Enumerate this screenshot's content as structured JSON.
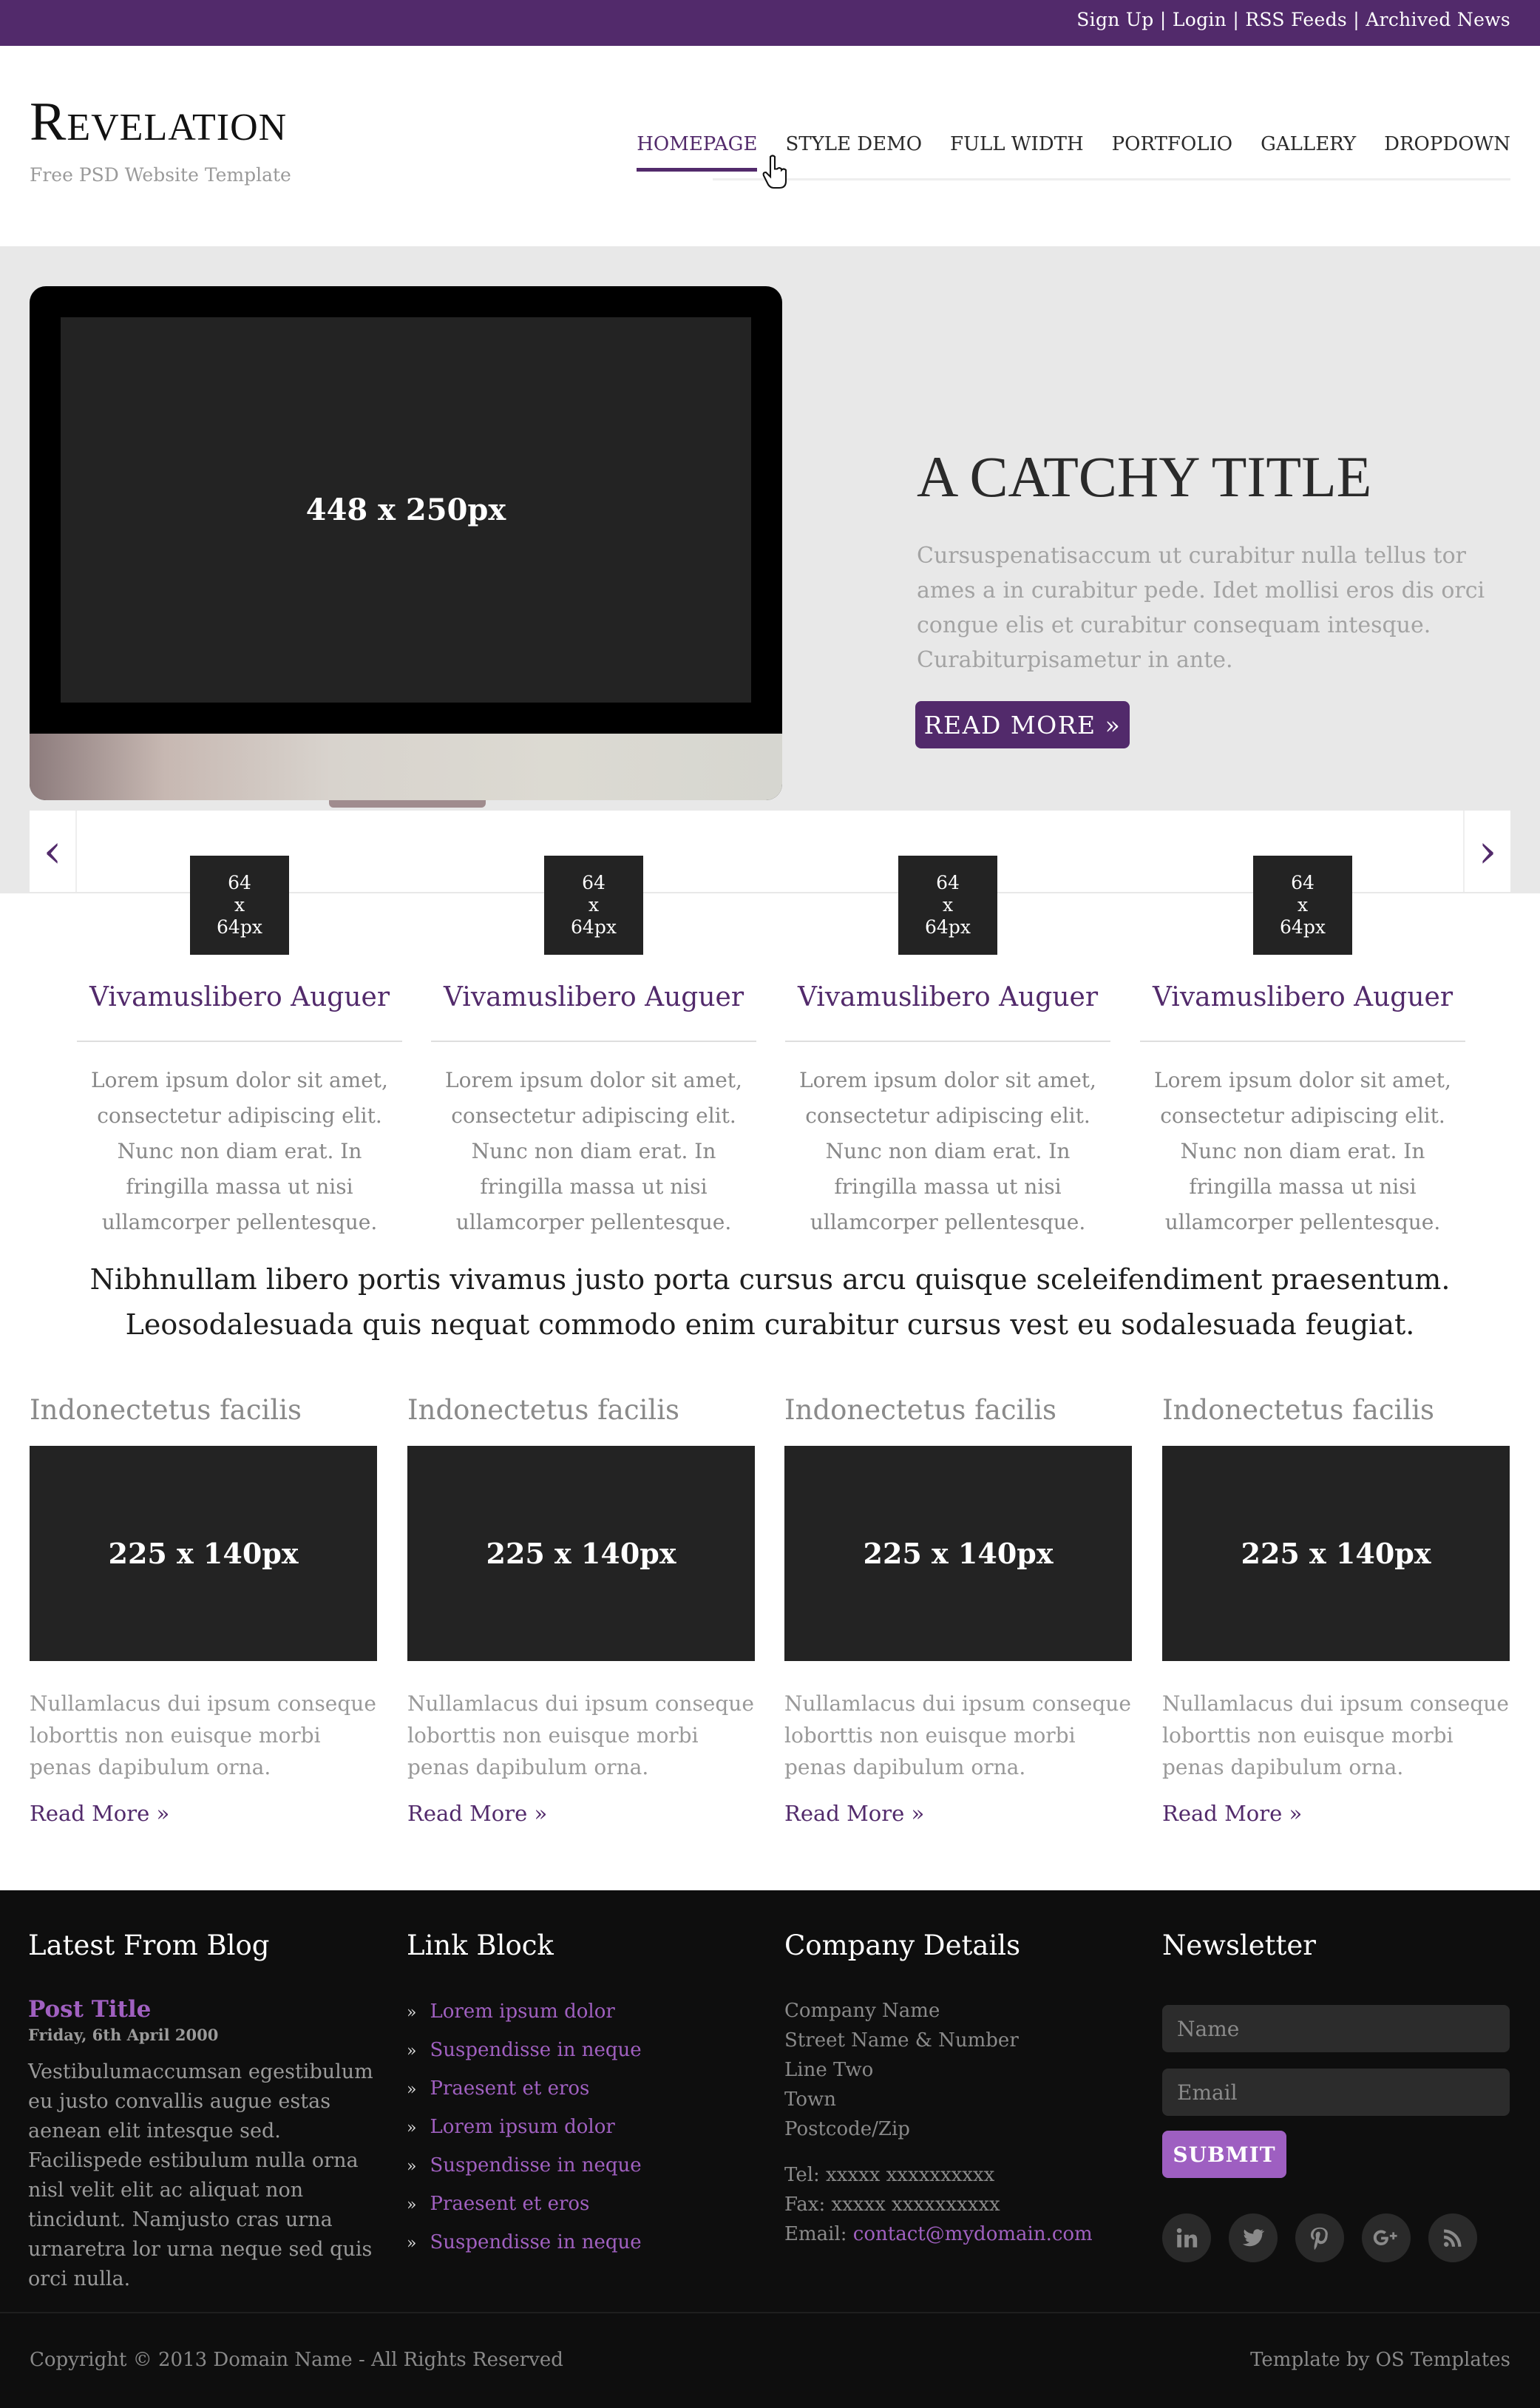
{
  "topbar": {
    "links": [
      "Sign Up",
      "Login",
      "RSS Feeds",
      "Archived News"
    ],
    "separator": " | "
  },
  "header": {
    "logo": "Revelation",
    "tagline": "Free PSD Website Template"
  },
  "nav": {
    "items": [
      "HOMEPAGE",
      "STYLE DEMO",
      "FULL WIDTH",
      "PORTFOLIO",
      "GALLERY",
      "DROPDOWN"
    ],
    "active": "HOMEPAGE"
  },
  "hero": {
    "image_placeholder": "448 x 250px",
    "title": "A CATCHY TITLE",
    "text": "Cursuspenatisaccum ut curabitur nulla tellus tor ames a in curabitur pede. Idet mollisi eros dis orci congue elis et curabitur consequam intesque. Curabiturpisametur in ante.",
    "button": "READ MORE »"
  },
  "carousel": {
    "prev": "‹",
    "next": "›",
    "items": [
      {
        "thumb": [
          "64",
          "x",
          "64px"
        ],
        "title": "Vivamuslibero Auguer",
        "text": "Lorem ipsum dolor sit amet, consectetur adipiscing elit. Nunc non diam erat. In fringilla massa ut nisi ullamcorper pellentesque."
      },
      {
        "thumb": [
          "64",
          "x",
          "64px"
        ],
        "title": "Vivamuslibero Auguer",
        "text": "Lorem ipsum dolor sit amet, consectetur adipiscing elit. Nunc non diam erat. In fringilla massa ut nisi ullamcorper pellentesque."
      },
      {
        "thumb": [
          "64",
          "x",
          "64px"
        ],
        "title": "Vivamuslibero Auguer",
        "text": "Lorem ipsum dolor sit amet, consectetur adipiscing elit. Nunc non diam erat. In fringilla massa ut nisi ullamcorper pellentesque."
      },
      {
        "thumb": [
          "64",
          "x",
          "64px"
        ],
        "title": "Vivamuslibero Auguer",
        "text": "Lorem ipsum dolor sit amet, consectetur adipiscing elit. Nunc non diam erat. In fringilla massa ut nisi ullamcorper pellentesque."
      }
    ]
  },
  "intro": "Nibhnullam libero portis vivamus justo porta cursus arcu quisque sceleifendiment praesentum. Leosodalesuada quis nequat commodo enim curabitur cursus vest eu sodalesuada feugiat.",
  "columns": [
    {
      "title": "Indonectetus facilis",
      "image": "225 x 140px",
      "text": "Nullamlacus dui ipsum conseque loborttis non euisque morbi penas dapibulum orna.",
      "link": "Read More »"
    },
    {
      "title": "Indonectetus facilis",
      "image": "225 x 140px",
      "text": "Nullamlacus dui ipsum conseque loborttis non euisque morbi penas dapibulum orna.",
      "link": "Read More »"
    },
    {
      "title": "Indonectetus facilis",
      "image": "225 x 140px",
      "text": "Nullamlacus dui ipsum conseque loborttis non euisque morbi penas dapibulum orna.",
      "link": "Read More »"
    },
    {
      "title": "Indonectetus facilis",
      "image": "225 x 140px",
      "text": "Nullamlacus dui ipsum conseque loborttis non euisque morbi penas dapibulum orna.",
      "link": "Read More »"
    }
  ],
  "footer": {
    "blog": {
      "heading": "Latest From Blog",
      "post_title": "Post Title",
      "post_date": "Friday, 6th April 2000",
      "post_body": "Vestibulumaccumsan egestibulum eu justo convallis augue estas aenean elit intesque sed. Facilispede estibulum nulla orna nisl velit elit ac aliquat non tincidunt. Namjusto cras urna urnaretra lor urna neque sed quis orci nulla."
    },
    "links": {
      "heading": "Link Block",
      "bullet": "»",
      "items": [
        "Lorem ipsum dolor",
        "Suspendisse in neque",
        "Praesent et eros",
        "Lorem ipsum dolor",
        "Suspendisse in neque",
        "Praesent et eros",
        "Suspendisse in neque"
      ]
    },
    "company": {
      "heading": "Company Details",
      "address": [
        "Company Name",
        "Street Name & Number",
        "Line Two",
        "Town",
        "Postcode/Zip"
      ],
      "tel": "Tel: xxxxx xxxxxxxxxx",
      "fax": "Fax: xxxxx xxxxxxxxxx",
      "email_label": "Email: ",
      "email": "contact@mydomain.com"
    },
    "newsletter": {
      "heading": "Newsletter",
      "name_placeholder": "Name",
      "email_placeholder": "Email",
      "submit": "SUBMIT",
      "social_icons": [
        "linkedin-icon",
        "twitter-icon",
        "pinterest-icon",
        "google-plus-icon",
        "rss-icon"
      ]
    },
    "copyright": "Copyright © 2013 Domain Name - All Rights Reserved",
    "credit": "Template by OS Templates"
  },
  "colors": {
    "brand_purple": "#522a6b",
    "link_purple": "#a060c0",
    "footer_bg": "#0e0e0e",
    "hero_bg": "#e8e8e8"
  }
}
